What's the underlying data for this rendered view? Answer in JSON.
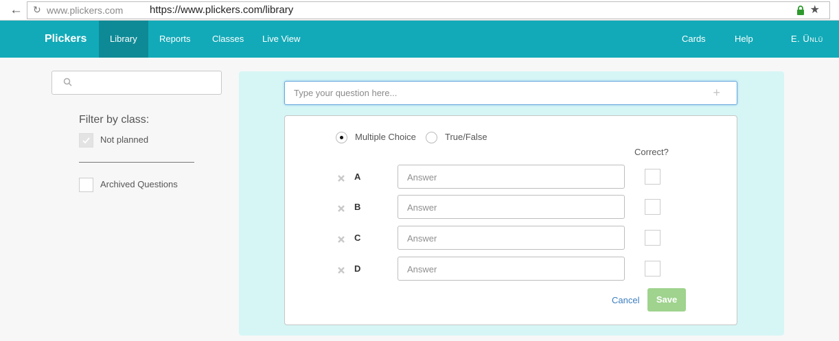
{
  "browser": {
    "url_prefix": "www.plickers.com",
    "url": "https://www.plickers.com/library"
  },
  "nav": {
    "brand": "Plickers",
    "items": [
      {
        "label": "Library",
        "active": true
      },
      {
        "label": "Reports",
        "active": false
      },
      {
        "label": "Classes",
        "active": false
      },
      {
        "label": "Live View",
        "active": false
      }
    ],
    "right": {
      "cards": "Cards",
      "help": "Help",
      "user": "E. Ünlü"
    },
    "color": "#12aab8",
    "active_color": "#0e8a96"
  },
  "sidebar": {
    "search_placeholder": "",
    "filter_title": "Filter by class:",
    "filters": [
      {
        "label": "Not planned",
        "checked": true
      },
      {
        "label": "Archived Questions",
        "checked": false
      }
    ]
  },
  "editor": {
    "question_placeholder": "Type your question here...",
    "types": [
      {
        "label": "Multiple Choice",
        "selected": true
      },
      {
        "label": "True/False",
        "selected": false
      }
    ],
    "correct_label": "Correct?",
    "answers": [
      {
        "letter": "A",
        "placeholder": "Answer",
        "correct": false
      },
      {
        "letter": "B",
        "placeholder": "Answer",
        "correct": false
      },
      {
        "letter": "C",
        "placeholder": "Answer",
        "correct": false
      },
      {
        "letter": "D",
        "placeholder": "Answer",
        "correct": false
      }
    ],
    "cancel_label": "Cancel",
    "save_label": "Save",
    "panel_color": "#d6f6f6",
    "save_color": "#9fd38e"
  }
}
